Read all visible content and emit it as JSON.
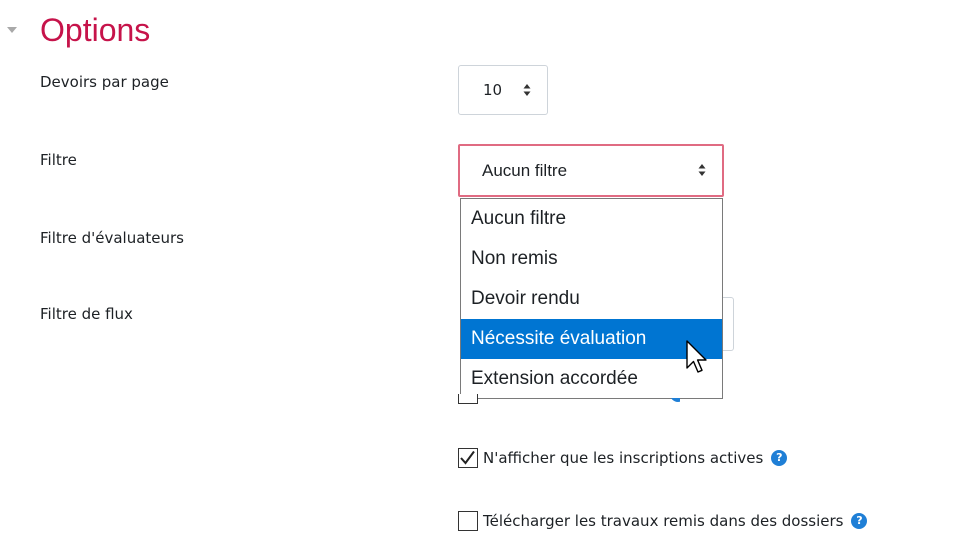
{
  "section": {
    "title": "Options",
    "toggle_icon": "triangle-down-icon"
  },
  "fields": {
    "per_page": {
      "label": "Devoirs par page",
      "value": "10"
    },
    "filter": {
      "label": "Filtre",
      "value": "Aucun filtre"
    },
    "marker_filter": {
      "label": "Filtre d'évaluateurs"
    },
    "workflow_filter": {
      "label": "Filtre de flux"
    }
  },
  "dropdown": {
    "options": [
      "Aucun filtre",
      "Non remis",
      "Devoir rendu",
      "Nécessite évaluation",
      "Extension accordée"
    ],
    "highlighted": "Nécessite évaluation"
  },
  "checkboxes": {
    "active_only": {
      "label": "N'afficher que les inscriptions actives",
      "checked": true
    },
    "download_folders": {
      "label": "Télécharger les travaux remis dans des dossiers",
      "checked": false
    }
  },
  "help_icon_glyph": "?",
  "colors": {
    "title": "#c6134a",
    "focus_border": "#e06b82",
    "highlight": "#0075d2",
    "help_icon": "#1f7fd6"
  }
}
